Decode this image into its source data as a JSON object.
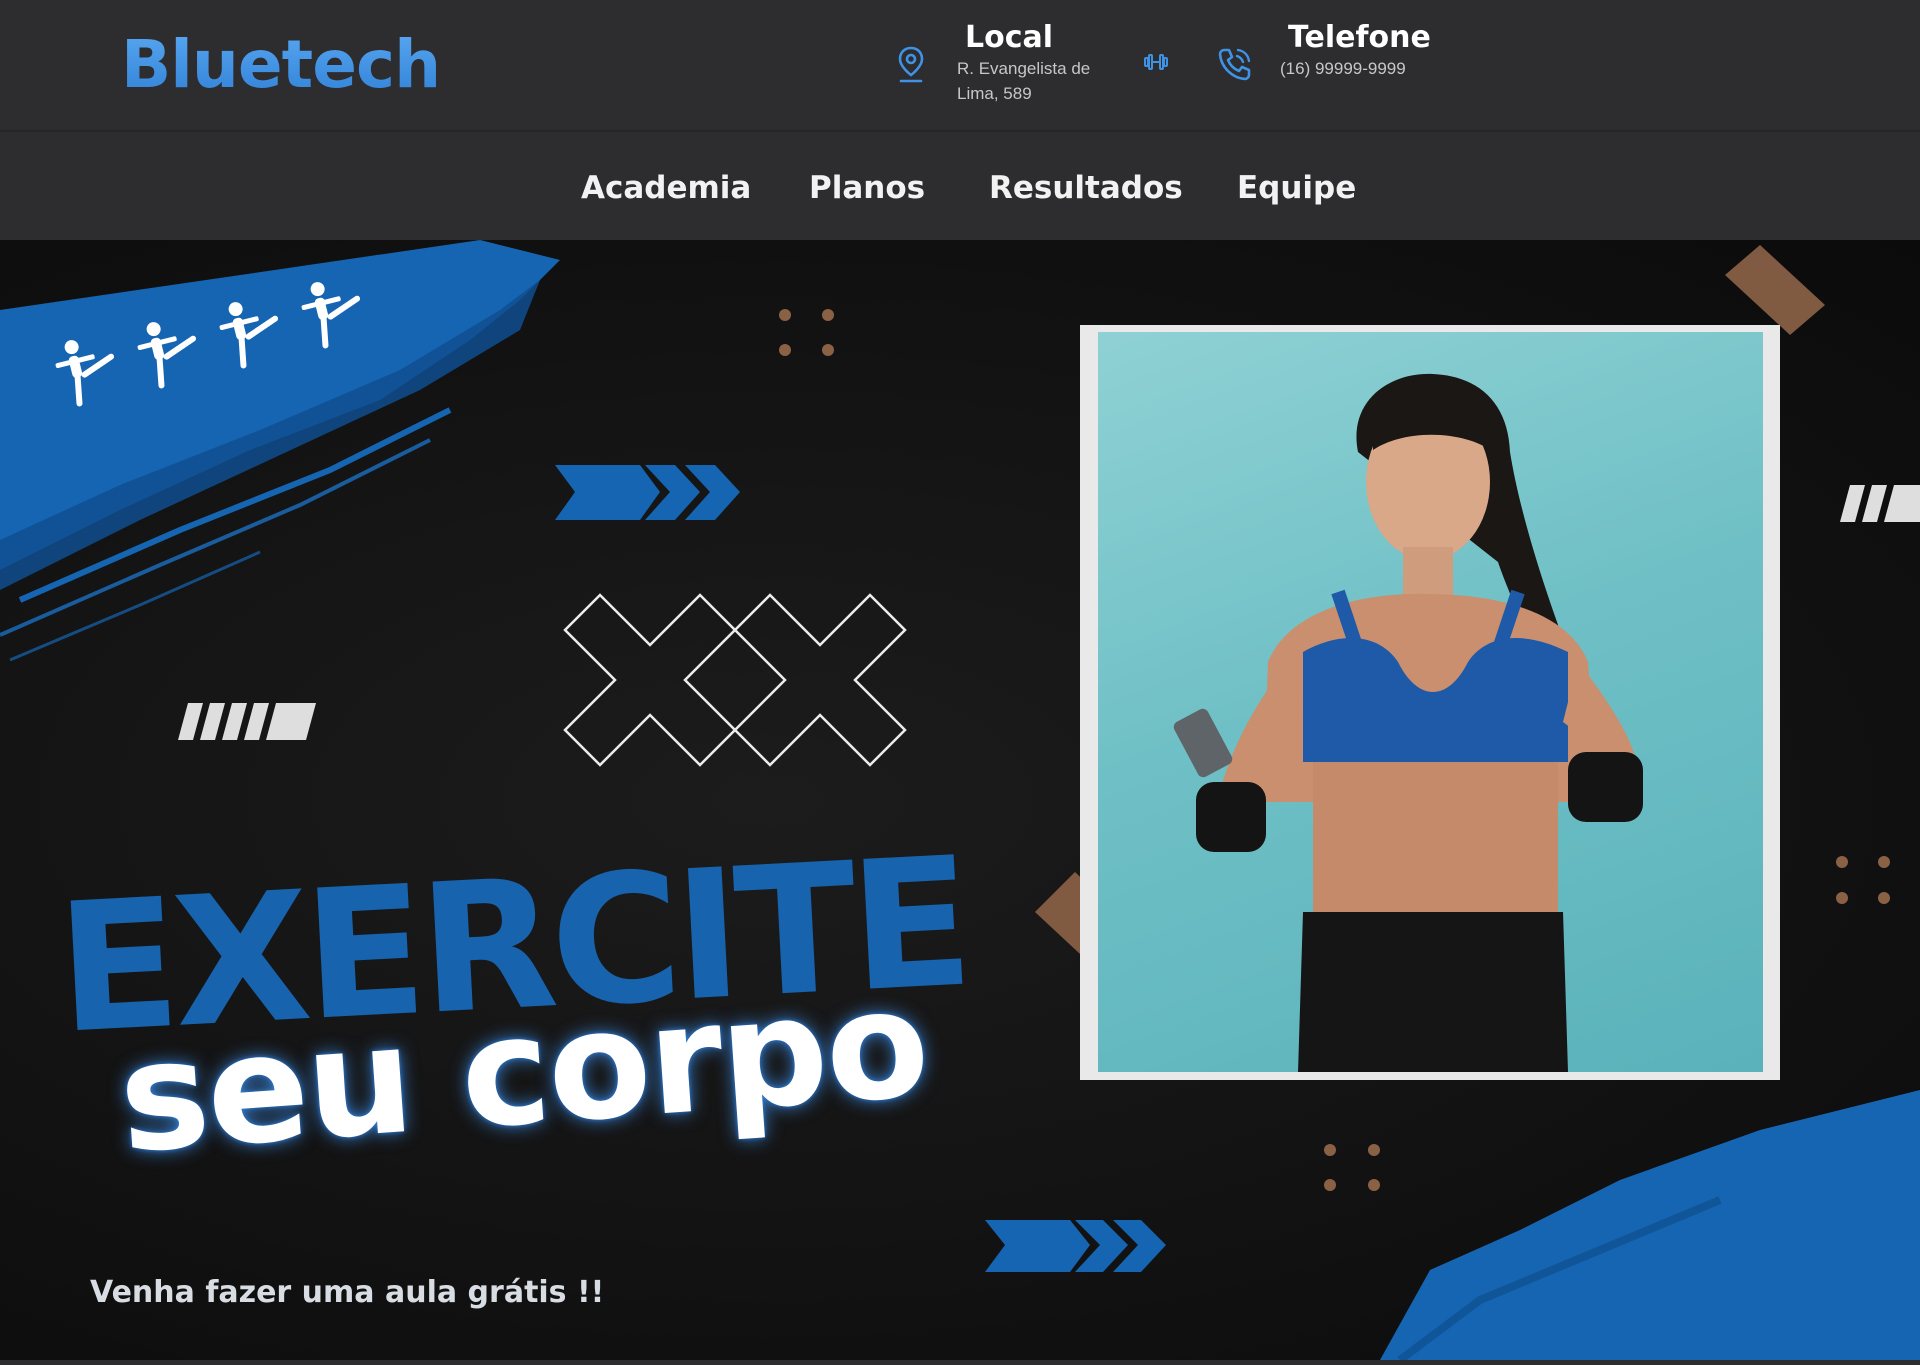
{
  "brand": {
    "logo": "Bluetech",
    "accent": "#3f93e6"
  },
  "header": {
    "local": {
      "title": "Local",
      "address_line1": "R. Evangelista de",
      "address_line2": "Lima, 589",
      "icon": "map-pin-icon"
    },
    "phone": {
      "title": "Telefone",
      "number": "(16) 99999-9999",
      "icon": "phone-icon"
    },
    "separator_icon": "dumbbell-icon"
  },
  "nav": {
    "items": [
      {
        "label": "Academia"
      },
      {
        "label": "Planos"
      },
      {
        "label": "Resultados"
      },
      {
        "label": "Equipe"
      }
    ]
  },
  "hero": {
    "headline_1": "EXERCITE",
    "headline_2": "seu corpo",
    "tagline": "Venha fazer uma aula grátis !!",
    "colors": {
      "blue": "#1763ad",
      "photo_bg": "#6fc0c6",
      "tape": "#8b6146"
    }
  }
}
